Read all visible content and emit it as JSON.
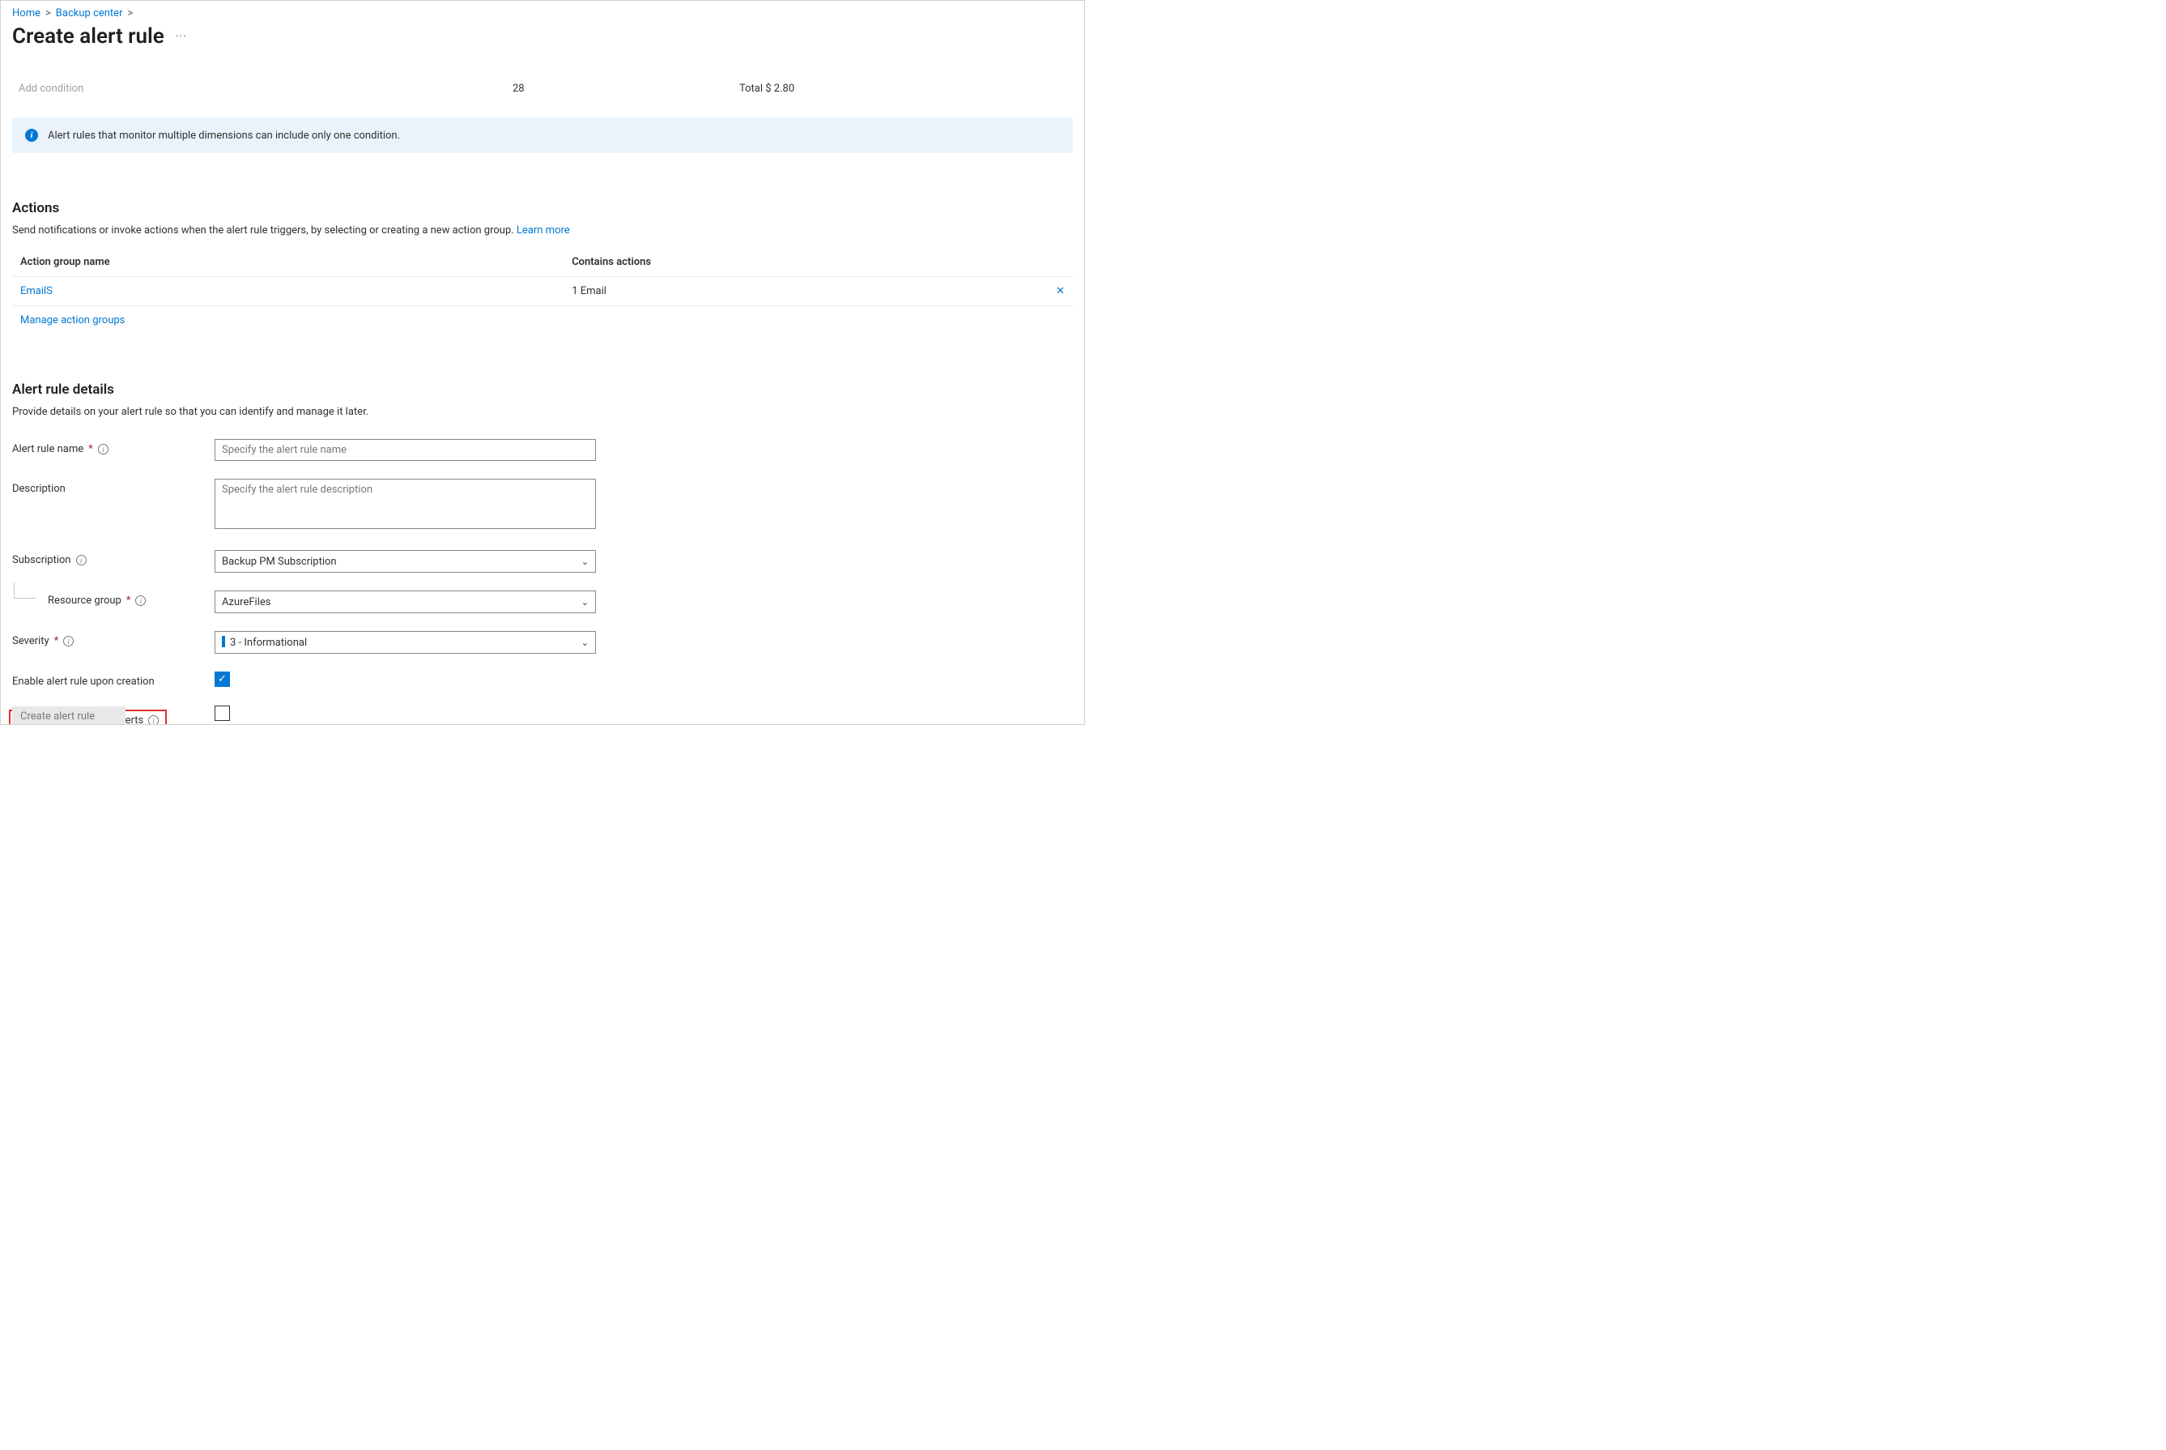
{
  "breadcrumb": {
    "home": "Home",
    "backup_center": "Backup center"
  },
  "page": {
    "title": "Create alert rule"
  },
  "strip": {
    "add_condition": "Add condition",
    "count": "28",
    "total": "Total $ 2.80"
  },
  "banner": {
    "text": "Alert rules that monitor multiple dimensions can include only one condition."
  },
  "actions": {
    "heading": "Actions",
    "desc": "Send notifications or invoke actions when the alert rule triggers, by selecting or creating a new action group. ",
    "learn_more": "Learn more",
    "col_name": "Action group name",
    "col_contains": "Contains actions",
    "row_name": "EmailS",
    "row_contains": "1 Email",
    "manage_link": "Manage action groups"
  },
  "details": {
    "heading": "Alert rule details",
    "desc": "Provide details on your alert rule so that you can identify and manage it later.",
    "name_label": "Alert rule name",
    "name_placeholder": "Specify the alert rule name",
    "desc_label": "Description",
    "desc_placeholder": "Specify the alert rule description",
    "sub_label": "Subscription",
    "sub_value": "Backup PM Subscription",
    "rg_label": "Resource group",
    "rg_value": "AzureFiles",
    "sev_label": "Severity",
    "sev_value": "3 - Informational",
    "enable_label": "Enable alert rule upon creation",
    "auto_label": "Automatically resolve alerts"
  },
  "footer": {
    "create": "Create alert rule"
  }
}
